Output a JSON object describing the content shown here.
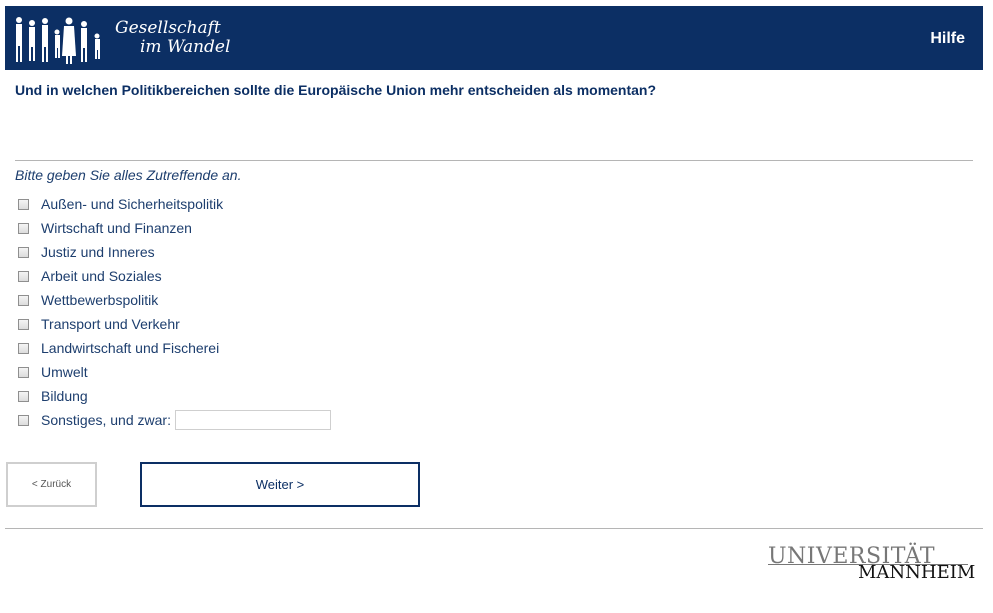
{
  "header": {
    "logo_line1": "Gesellschaft",
    "logo_line2": "im Wandel",
    "help_label": "Hilfe",
    "bg_color": "#0c2f64"
  },
  "question": {
    "text": "Und in welchen Politikbereichen sollte die Europäische Union mehr entscheiden als momentan?",
    "instruction": "Bitte geben Sie alles Zutreffende an."
  },
  "options": [
    {
      "label": "Außen- und Sicherheitspolitik",
      "checked": false
    },
    {
      "label": "Wirtschaft und Finanzen",
      "checked": false
    },
    {
      "label": "Justiz und Inneres",
      "checked": false
    },
    {
      "label": "Arbeit und Soziales",
      "checked": false
    },
    {
      "label": "Wettbewerbspolitik",
      "checked": false
    },
    {
      "label": "Transport und Verkehr",
      "checked": false
    },
    {
      "label": "Landwirtschaft und Fischerei",
      "checked": false
    },
    {
      "label": "Umwelt",
      "checked": false
    },
    {
      "label": "Bildung",
      "checked": false
    },
    {
      "label": "Sonstiges, und zwar:",
      "checked": false,
      "other_value": ""
    }
  ],
  "nav": {
    "back_label": "< Zurück",
    "next_label": "Weiter >"
  },
  "footer": {
    "uni_top": "UNIVERSITÄT",
    "uni_bottom": "MANNHEIM"
  }
}
